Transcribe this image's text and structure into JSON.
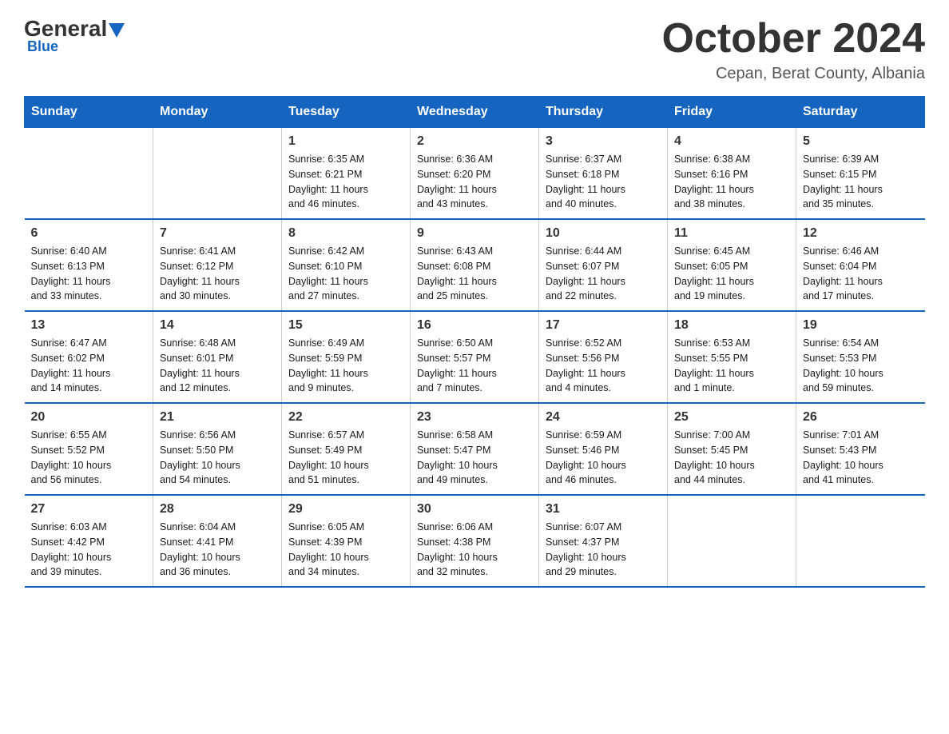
{
  "header": {
    "logo_general": "General",
    "logo_blue": "Blue",
    "month_title": "October 2024",
    "location": "Cepan, Berat County, Albania"
  },
  "weekdays": [
    "Sunday",
    "Monday",
    "Tuesday",
    "Wednesday",
    "Thursday",
    "Friday",
    "Saturday"
  ],
  "weeks": [
    [
      {
        "day": "",
        "info": ""
      },
      {
        "day": "",
        "info": ""
      },
      {
        "day": "1",
        "info": "Sunrise: 6:35 AM\nSunset: 6:21 PM\nDaylight: 11 hours\nand 46 minutes."
      },
      {
        "day": "2",
        "info": "Sunrise: 6:36 AM\nSunset: 6:20 PM\nDaylight: 11 hours\nand 43 minutes."
      },
      {
        "day": "3",
        "info": "Sunrise: 6:37 AM\nSunset: 6:18 PM\nDaylight: 11 hours\nand 40 minutes."
      },
      {
        "day": "4",
        "info": "Sunrise: 6:38 AM\nSunset: 6:16 PM\nDaylight: 11 hours\nand 38 minutes."
      },
      {
        "day": "5",
        "info": "Sunrise: 6:39 AM\nSunset: 6:15 PM\nDaylight: 11 hours\nand 35 minutes."
      }
    ],
    [
      {
        "day": "6",
        "info": "Sunrise: 6:40 AM\nSunset: 6:13 PM\nDaylight: 11 hours\nand 33 minutes."
      },
      {
        "day": "7",
        "info": "Sunrise: 6:41 AM\nSunset: 6:12 PM\nDaylight: 11 hours\nand 30 minutes."
      },
      {
        "day": "8",
        "info": "Sunrise: 6:42 AM\nSunset: 6:10 PM\nDaylight: 11 hours\nand 27 minutes."
      },
      {
        "day": "9",
        "info": "Sunrise: 6:43 AM\nSunset: 6:08 PM\nDaylight: 11 hours\nand 25 minutes."
      },
      {
        "day": "10",
        "info": "Sunrise: 6:44 AM\nSunset: 6:07 PM\nDaylight: 11 hours\nand 22 minutes."
      },
      {
        "day": "11",
        "info": "Sunrise: 6:45 AM\nSunset: 6:05 PM\nDaylight: 11 hours\nand 19 minutes."
      },
      {
        "day": "12",
        "info": "Sunrise: 6:46 AM\nSunset: 6:04 PM\nDaylight: 11 hours\nand 17 minutes."
      }
    ],
    [
      {
        "day": "13",
        "info": "Sunrise: 6:47 AM\nSunset: 6:02 PM\nDaylight: 11 hours\nand 14 minutes."
      },
      {
        "day": "14",
        "info": "Sunrise: 6:48 AM\nSunset: 6:01 PM\nDaylight: 11 hours\nand 12 minutes."
      },
      {
        "day": "15",
        "info": "Sunrise: 6:49 AM\nSunset: 5:59 PM\nDaylight: 11 hours\nand 9 minutes."
      },
      {
        "day": "16",
        "info": "Sunrise: 6:50 AM\nSunset: 5:57 PM\nDaylight: 11 hours\nand 7 minutes."
      },
      {
        "day": "17",
        "info": "Sunrise: 6:52 AM\nSunset: 5:56 PM\nDaylight: 11 hours\nand 4 minutes."
      },
      {
        "day": "18",
        "info": "Sunrise: 6:53 AM\nSunset: 5:55 PM\nDaylight: 11 hours\nand 1 minute."
      },
      {
        "day": "19",
        "info": "Sunrise: 6:54 AM\nSunset: 5:53 PM\nDaylight: 10 hours\nand 59 minutes."
      }
    ],
    [
      {
        "day": "20",
        "info": "Sunrise: 6:55 AM\nSunset: 5:52 PM\nDaylight: 10 hours\nand 56 minutes."
      },
      {
        "day": "21",
        "info": "Sunrise: 6:56 AM\nSunset: 5:50 PM\nDaylight: 10 hours\nand 54 minutes."
      },
      {
        "day": "22",
        "info": "Sunrise: 6:57 AM\nSunset: 5:49 PM\nDaylight: 10 hours\nand 51 minutes."
      },
      {
        "day": "23",
        "info": "Sunrise: 6:58 AM\nSunset: 5:47 PM\nDaylight: 10 hours\nand 49 minutes."
      },
      {
        "day": "24",
        "info": "Sunrise: 6:59 AM\nSunset: 5:46 PM\nDaylight: 10 hours\nand 46 minutes."
      },
      {
        "day": "25",
        "info": "Sunrise: 7:00 AM\nSunset: 5:45 PM\nDaylight: 10 hours\nand 44 minutes."
      },
      {
        "day": "26",
        "info": "Sunrise: 7:01 AM\nSunset: 5:43 PM\nDaylight: 10 hours\nand 41 minutes."
      }
    ],
    [
      {
        "day": "27",
        "info": "Sunrise: 6:03 AM\nSunset: 4:42 PM\nDaylight: 10 hours\nand 39 minutes."
      },
      {
        "day": "28",
        "info": "Sunrise: 6:04 AM\nSunset: 4:41 PM\nDaylight: 10 hours\nand 36 minutes."
      },
      {
        "day": "29",
        "info": "Sunrise: 6:05 AM\nSunset: 4:39 PM\nDaylight: 10 hours\nand 34 minutes."
      },
      {
        "day": "30",
        "info": "Sunrise: 6:06 AM\nSunset: 4:38 PM\nDaylight: 10 hours\nand 32 minutes."
      },
      {
        "day": "31",
        "info": "Sunrise: 6:07 AM\nSunset: 4:37 PM\nDaylight: 10 hours\nand 29 minutes."
      },
      {
        "day": "",
        "info": ""
      },
      {
        "day": "",
        "info": ""
      }
    ]
  ]
}
